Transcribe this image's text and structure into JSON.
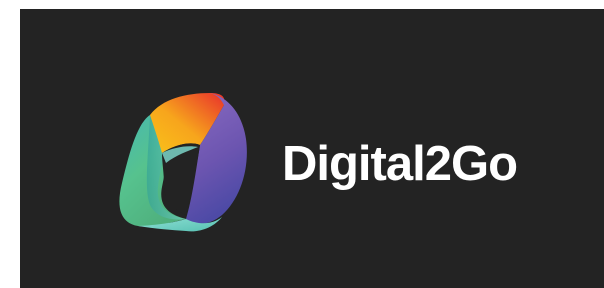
{
  "brand": {
    "name": "Digital2Go",
    "logo_icon": "mobius-ribbon-logo-icon",
    "colors": {
      "background": "#232323",
      "wordmark": "#ffffff",
      "ribbon_orange": "#f7a51c",
      "ribbon_red": "#ee3b2a",
      "ribbon_purple": "#7456b4",
      "ribbon_green": "#5ec28f",
      "ribbon_teal": "#6fd0c8"
    }
  }
}
